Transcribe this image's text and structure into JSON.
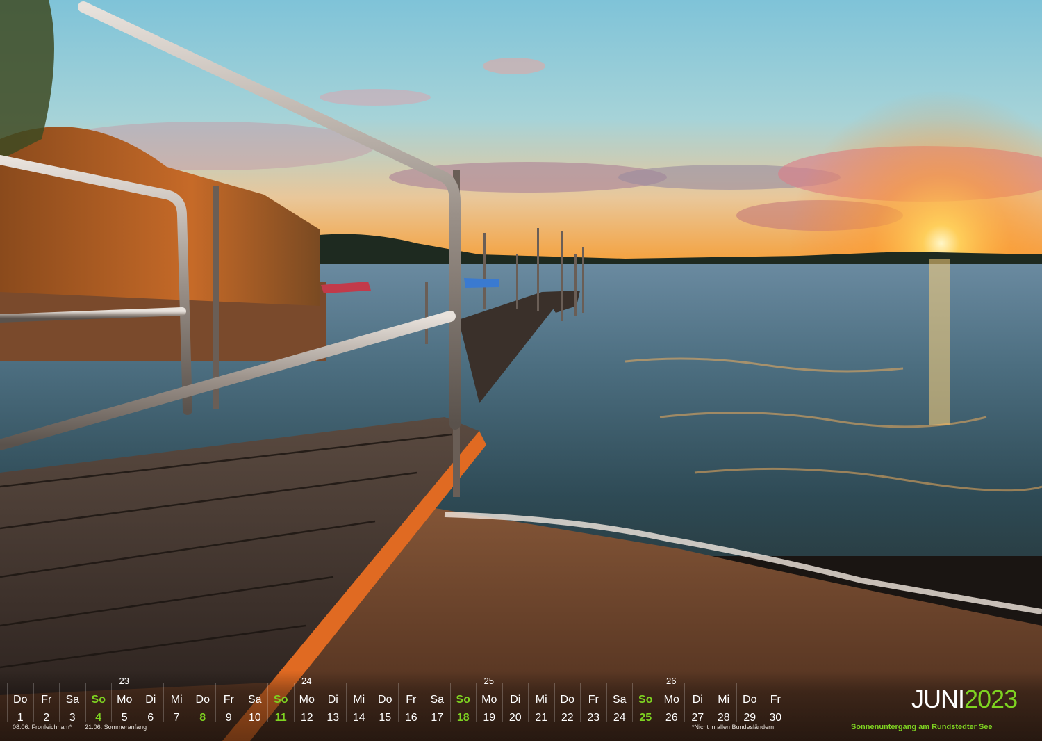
{
  "calendar": {
    "month": "JUNI",
    "year": "2023",
    "caption": "Sonnenuntergang am Rundstedter See",
    "accent_color": "#7ed321",
    "days": [
      {
        "name": "Do",
        "date": "1"
      },
      {
        "name": "Fr",
        "date": "2"
      },
      {
        "name": "Sa",
        "date": "3"
      },
      {
        "name": "So",
        "date": "4",
        "sunday": true
      },
      {
        "name": "Mo",
        "date": "5"
      },
      {
        "name": "Di",
        "date": "6"
      },
      {
        "name": "Mi",
        "date": "7"
      },
      {
        "name": "Do",
        "date": "8",
        "holiday": true
      },
      {
        "name": "Fr",
        "date": "9"
      },
      {
        "name": "Sa",
        "date": "10"
      },
      {
        "name": "So",
        "date": "11",
        "sunday": true
      },
      {
        "name": "Mo",
        "date": "12"
      },
      {
        "name": "Di",
        "date": "13"
      },
      {
        "name": "Mi",
        "date": "14"
      },
      {
        "name": "Do",
        "date": "15"
      },
      {
        "name": "Fr",
        "date": "16"
      },
      {
        "name": "Sa",
        "date": "17"
      },
      {
        "name": "So",
        "date": "18",
        "sunday": true
      },
      {
        "name": "Mo",
        "date": "19"
      },
      {
        "name": "Di",
        "date": "20"
      },
      {
        "name": "Mi",
        "date": "21"
      },
      {
        "name": "Do",
        "date": "22"
      },
      {
        "name": "Fr",
        "date": "23"
      },
      {
        "name": "Sa",
        "date": "24"
      },
      {
        "name": "So",
        "date": "25",
        "sunday": true
      },
      {
        "name": "Mo",
        "date": "26"
      },
      {
        "name": "Di",
        "date": "27"
      },
      {
        "name": "Mi",
        "date": "28"
      },
      {
        "name": "Do",
        "date": "29"
      },
      {
        "name": "Fr",
        "date": "30"
      }
    ],
    "weeks": [
      {
        "number": "23",
        "day_index": 4
      },
      {
        "number": "24",
        "day_index": 11
      },
      {
        "number": "25",
        "day_index": 18
      },
      {
        "number": "26",
        "day_index": 25
      }
    ],
    "notes": [
      "08.06. Fronleichnam*",
      "21.06. Sommeranfang"
    ],
    "footnote": "*Nicht in allen Bundesländern"
  }
}
